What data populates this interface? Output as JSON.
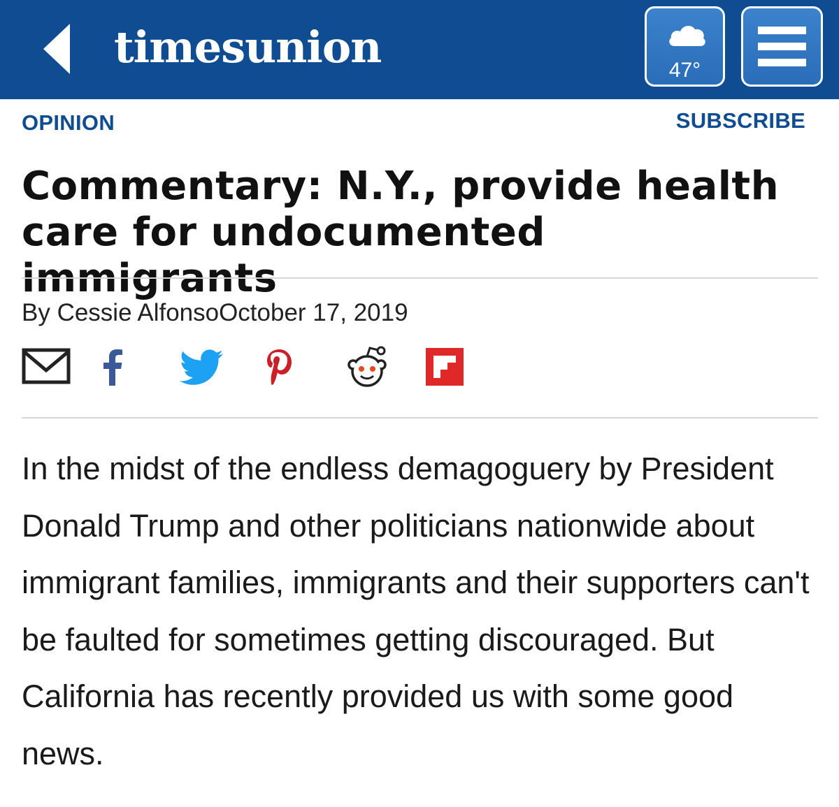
{
  "header": {
    "logo": "timesunion",
    "weather": {
      "icon": "cloud-icon",
      "temperature": "47°"
    },
    "background_color": "#0f4c92"
  },
  "section": {
    "label": "OPINION"
  },
  "subscribe": {
    "label": "SUBSCRIBE"
  },
  "article": {
    "headline": "Commentary: N.Y., provide health care for undocumented immigrants",
    "byline": "By Cessie AlfonsoOctober 17, 2019",
    "body": "In the midst of the endless demagoguery by President Donald Trump and other politicians nationwide about immigrant families, immigrants and their supporters can't be faulted for sometimes getting discouraged. But California has recently provided us with some good news."
  },
  "share_icons": [
    "email-icon",
    "facebook-icon",
    "twitter-icon",
    "pinterest-icon",
    "reddit-icon",
    "flipboard-icon"
  ],
  "colors": {
    "brand_blue": "#0f4c92",
    "facebook": "#3b5998",
    "twitter": "#1da1f2",
    "pinterest": "#cb2027",
    "flipboard": "#e12828"
  }
}
